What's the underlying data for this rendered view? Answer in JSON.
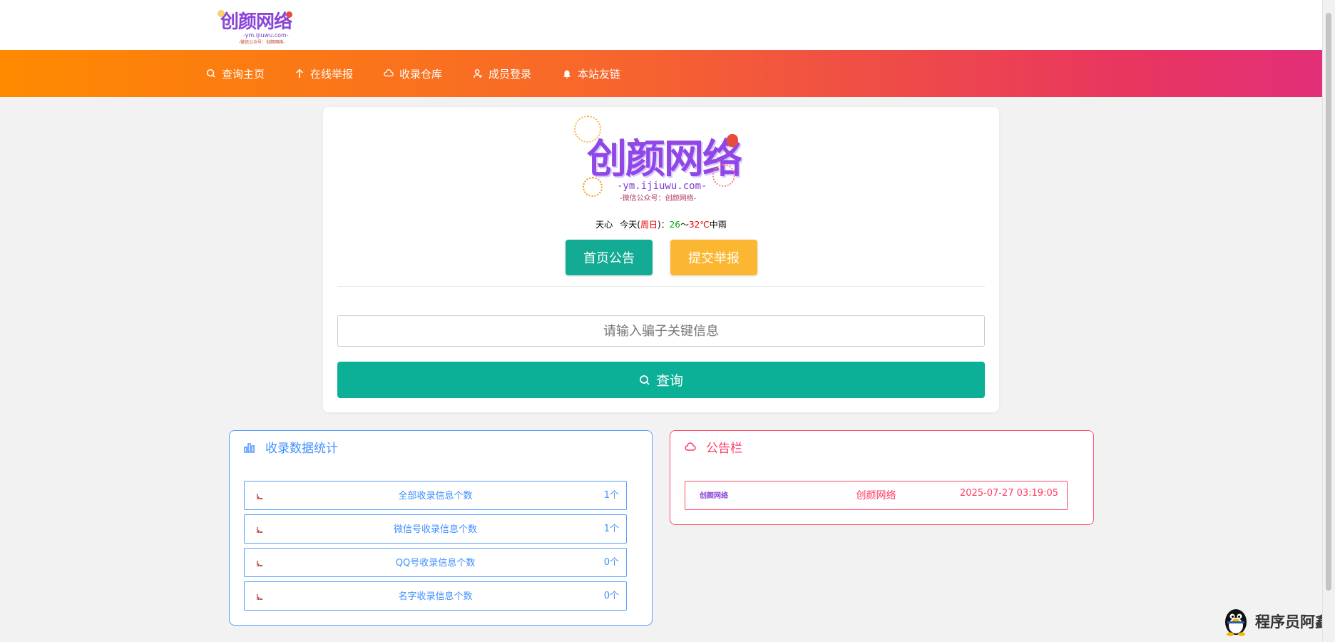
{
  "header": {
    "logo": {
      "name": "创颜网络",
      "domain": "-ym.ijiuwu.com-",
      "slogan": "-微信公众号：创颜网络-"
    }
  },
  "nav": {
    "items": [
      {
        "label": "查询主页",
        "icon": "search-icon"
      },
      {
        "label": "在线举报",
        "icon": "arrow-up-icon"
      },
      {
        "label": "收录仓库",
        "icon": "cloud-icon"
      },
      {
        "label": "成员登录",
        "icon": "user-icon"
      },
      {
        "label": "本站友链",
        "icon": "bell-icon"
      }
    ]
  },
  "main": {
    "logo": {
      "name": "创颜网络",
      "domain": "-ym.ijiuwu.com-",
      "slogan": "-微信公众号：创颜网络-"
    },
    "weather": {
      "city": "天心",
      "today": "今天(",
      "day": "周日",
      "sep": ")：",
      "low": "26",
      "tilde": "～",
      "high": "32℃",
      "condition": "中雨"
    },
    "buttons": {
      "notice": "首页公告",
      "report": "提交举报"
    },
    "search": {
      "placeholder": "请输入骗子关键信息",
      "button": "查询"
    }
  },
  "stats": {
    "title": "收录数据统计",
    "rows": [
      {
        "label": "全部收录信息个数",
        "count": "1个"
      },
      {
        "label": "微信号收录信息个数",
        "count": "1个"
      },
      {
        "label": "QQ号收录信息个数",
        "count": "0个"
      },
      {
        "label": "名字收录信息个数",
        "count": "0个"
      }
    ]
  },
  "notice": {
    "title": "公告栏",
    "items": [
      {
        "logo": "创颜网络",
        "title": "创颜网络",
        "time": "2025-07-27 03:19:05"
      }
    ]
  },
  "watermark": {
    "text": "程序员阿鑫"
  },
  "colors": {
    "nav_gradient_start": "#ff8a00",
    "nav_gradient_end": "#e22f78",
    "primary_green": "#0bb096",
    "accent_yellow": "#fbb731",
    "stats_blue": "#3f8fff",
    "notice_red": "#ff3860"
  }
}
